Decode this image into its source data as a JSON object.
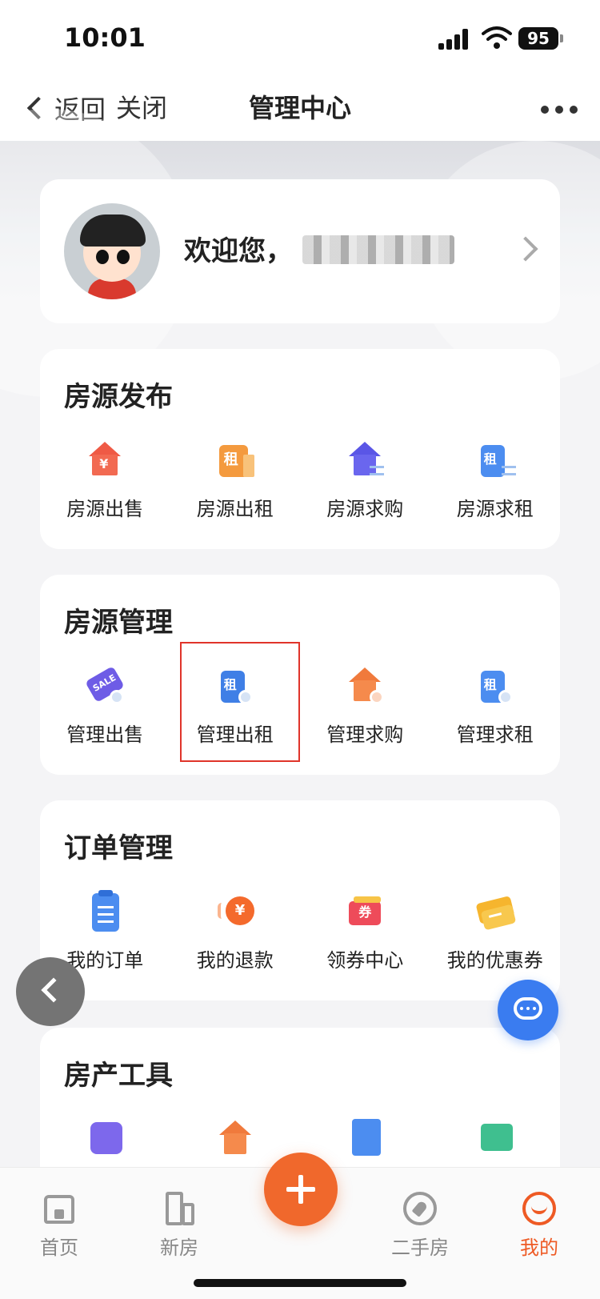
{
  "status_bar": {
    "time": "10:01",
    "battery": "95"
  },
  "nav": {
    "back_label": "返回",
    "close_label": "关闭",
    "title": "管理中心"
  },
  "profile": {
    "welcome": "欢迎您，"
  },
  "sections": {
    "publish": {
      "title": "房源发布",
      "items": [
        "房源出售",
        "房源出租",
        "房源求购",
        "房源求租"
      ]
    },
    "manage": {
      "title": "房源管理",
      "items": [
        "管理出售",
        "管理出租",
        "管理求购",
        "管理求租"
      ]
    },
    "orders": {
      "title": "订单管理",
      "items": [
        "我的订单",
        "我的退款",
        "领券中心",
        "我的优惠券"
      ]
    },
    "tools": {
      "title": "房产工具"
    }
  },
  "icon_glyphs": {
    "yen": "¥",
    "rent": "租",
    "sale": "SALE",
    "coupon": "券"
  },
  "tabs": [
    "首页",
    "新房",
    "二手房",
    "我的"
  ],
  "colors": {
    "accent": "#ee5a24",
    "chat_button": "#3a7cf0",
    "highlight": "#e0342a"
  }
}
